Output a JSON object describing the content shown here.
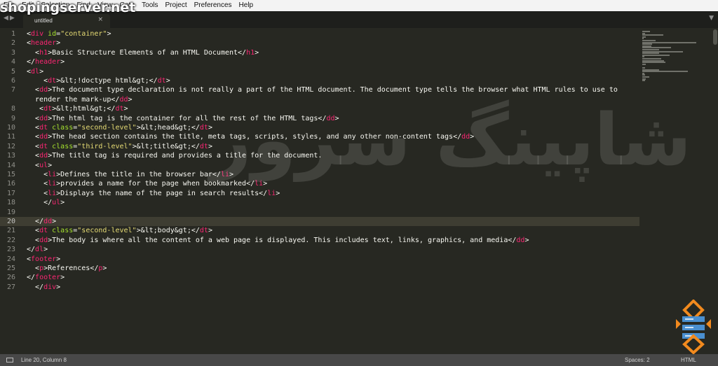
{
  "menu": [
    "File",
    "Edit",
    "Selection",
    "Find",
    "View",
    "Goto",
    "Tools",
    "Project",
    "Preferences",
    "Help"
  ],
  "watermark": {
    "url": "shopingserver.net",
    "brand": "شاپینگ سرور"
  },
  "tab": {
    "label": "untitled",
    "close_glyph": "×",
    "nav_arrows": "◀▶",
    "dropdown_glyph": "▼"
  },
  "colors": {
    "background": "#272822",
    "tag": "#f92672",
    "attribute": "#a6e22e",
    "string": "#e6db74",
    "text": "#f8f8f2",
    "logo_accent": "#f28a1e"
  },
  "active_line": 20,
  "lines": [
    {
      "n": "1",
      "tokens": [
        [
          "p",
          "<"
        ],
        [
          "t",
          "div"
        ],
        [
          "p",
          " "
        ],
        [
          "a",
          "id"
        ],
        [
          "p",
          "="
        ],
        [
          "s",
          "\"container\""
        ],
        [
          "p",
          ">"
        ]
      ]
    },
    {
      "n": "2",
      "tokens": [
        [
          "p",
          "<"
        ],
        [
          "t",
          "header"
        ],
        [
          "p",
          ">"
        ]
      ]
    },
    {
      "n": "3",
      "tokens": [
        [
          "p",
          "  <"
        ],
        [
          "t",
          "h1"
        ],
        [
          "p",
          ">Basic Structure Elements of an HTML Document</"
        ],
        [
          "t",
          "h1"
        ],
        [
          "p",
          ">"
        ]
      ]
    },
    {
      "n": "4",
      "tokens": [
        [
          "p",
          "</"
        ],
        [
          "t",
          "header"
        ],
        [
          "p",
          ">"
        ]
      ]
    },
    {
      "n": "5",
      "tokens": [
        [
          "p",
          "<"
        ],
        [
          "t",
          "dl"
        ],
        [
          "p",
          ">"
        ]
      ]
    },
    {
      "n": "6",
      "tokens": [
        [
          "p",
          "    <"
        ],
        [
          "t",
          "dt"
        ],
        [
          "p",
          ">&lt;!doctype html&gt;</"
        ],
        [
          "t",
          "dt"
        ],
        [
          "p",
          ">"
        ]
      ]
    },
    {
      "n": "7",
      "tokens": [
        [
          "p",
          "  <"
        ],
        [
          "t",
          "dd"
        ],
        [
          "p",
          ">The document type declaration is not really a part of the HTML document. The document type tells the browser what HTML rules to use to"
        ]
      ]
    },
    {
      "n": "",
      "tokens": [
        [
          "p",
          "  render the mark-up</"
        ],
        [
          "t",
          "dd"
        ],
        [
          "p",
          ">"
        ]
      ]
    },
    {
      "n": "8",
      "tokens": [
        [
          "p",
          "   <"
        ],
        [
          "t",
          "dt"
        ],
        [
          "p",
          ">&lt;html&gt;</"
        ],
        [
          "t",
          "dt"
        ],
        [
          "p",
          ">"
        ]
      ]
    },
    {
      "n": "9",
      "tokens": [
        [
          "p",
          "  <"
        ],
        [
          "t",
          "dd"
        ],
        [
          "p",
          ">The html tag is the container for all the rest of the HTML tags</"
        ],
        [
          "t",
          "dd"
        ],
        [
          "p",
          ">"
        ]
      ]
    },
    {
      "n": "10",
      "tokens": [
        [
          "p",
          "  <"
        ],
        [
          "t",
          "dt"
        ],
        [
          "p",
          " "
        ],
        [
          "a",
          "class"
        ],
        [
          "p",
          "="
        ],
        [
          "s",
          "\"second-level\""
        ],
        [
          "p",
          ">&lt;head&gt;</"
        ],
        [
          "t",
          "dt"
        ],
        [
          "p",
          ">"
        ]
      ]
    },
    {
      "n": "11",
      "tokens": [
        [
          "p",
          "  <"
        ],
        [
          "t",
          "dd"
        ],
        [
          "p",
          ">The head section contains the title, meta tags, scripts, styles, and any other non-content tags</"
        ],
        [
          "t",
          "dd"
        ],
        [
          "p",
          ">"
        ]
      ]
    },
    {
      "n": "12",
      "tokens": [
        [
          "p",
          "  <"
        ],
        [
          "t",
          "dt"
        ],
        [
          "p",
          " "
        ],
        [
          "a",
          "class"
        ],
        [
          "p",
          "="
        ],
        [
          "s",
          "\"third-level\""
        ],
        [
          "p",
          ">&lt;title&gt;</"
        ],
        [
          "t",
          "dt"
        ],
        [
          "p",
          ">"
        ]
      ]
    },
    {
      "n": "13",
      "tokens": [
        [
          "p",
          "  <"
        ],
        [
          "t",
          "dd"
        ],
        [
          "p",
          ">The title tag is required and provides a title for the document."
        ]
      ]
    },
    {
      "n": "14",
      "tokens": [
        [
          "p",
          "  <"
        ],
        [
          "t",
          "ul"
        ],
        [
          "p",
          ">"
        ]
      ]
    },
    {
      "n": "15",
      "tokens": [
        [
          "p",
          "    <"
        ],
        [
          "t",
          "li"
        ],
        [
          "p",
          ">Defines the title in the browser bar</"
        ],
        [
          "t",
          "li"
        ],
        [
          "p",
          ">"
        ]
      ]
    },
    {
      "n": "16",
      "tokens": [
        [
          "p",
          "    <"
        ],
        [
          "t",
          "li"
        ],
        [
          "p",
          ">provides a name for the page when bookmarked</"
        ],
        [
          "t",
          "li"
        ],
        [
          "p",
          ">"
        ]
      ]
    },
    {
      "n": "17",
      "tokens": [
        [
          "p",
          "    <"
        ],
        [
          "t",
          "li"
        ],
        [
          "p",
          ">Displays the name of the page in search results</"
        ],
        [
          "t",
          "li"
        ],
        [
          "p",
          ">"
        ]
      ]
    },
    {
      "n": "18",
      "tokens": [
        [
          "p",
          "    </"
        ],
        [
          "t",
          "ul"
        ],
        [
          "p",
          ">"
        ]
      ]
    },
    {
      "n": "19",
      "tokens": []
    },
    {
      "n": "20",
      "tokens": [
        [
          "p",
          "  </"
        ],
        [
          "t",
          "dd"
        ],
        [
          "p",
          ">"
        ]
      ]
    },
    {
      "n": "21",
      "tokens": [
        [
          "p",
          "  <"
        ],
        [
          "t",
          "dt"
        ],
        [
          "p",
          " "
        ],
        [
          "a",
          "class"
        ],
        [
          "p",
          "="
        ],
        [
          "s",
          "\"second-level\""
        ],
        [
          "p",
          ">&lt;body&gt;</"
        ],
        [
          "t",
          "dt"
        ],
        [
          "p",
          ">"
        ]
      ]
    },
    {
      "n": "22",
      "tokens": [
        [
          "p",
          "  <"
        ],
        [
          "t",
          "dd"
        ],
        [
          "p",
          ">The body is where all the content of a web page is displayed. This includes text, links, graphics, and media</"
        ],
        [
          "t",
          "dd"
        ],
        [
          "p",
          ">"
        ]
      ]
    },
    {
      "n": "23",
      "tokens": [
        [
          "p",
          "</"
        ],
        [
          "t",
          "dl"
        ],
        [
          "p",
          ">"
        ]
      ]
    },
    {
      "n": "24",
      "tokens": [
        [
          "p",
          "<"
        ],
        [
          "t",
          "footer"
        ],
        [
          "p",
          ">"
        ]
      ]
    },
    {
      "n": "25",
      "tokens": [
        [
          "p",
          "  <"
        ],
        [
          "t",
          "p"
        ],
        [
          "p",
          ">References</"
        ],
        [
          "t",
          "p"
        ],
        [
          "p",
          ">"
        ]
      ]
    },
    {
      "n": "26",
      "tokens": [
        [
          "p",
          "</"
        ],
        [
          "t",
          "footer"
        ],
        [
          "p",
          ">"
        ]
      ]
    },
    {
      "n": "27",
      "tokens": [
        [
          "p",
          "  </"
        ],
        [
          "t",
          "div"
        ],
        [
          "p",
          ">"
        ]
      ]
    }
  ],
  "status": {
    "position": "Line 20, Column 8",
    "spaces": "Spaces: 2",
    "syntax": "HTML"
  }
}
